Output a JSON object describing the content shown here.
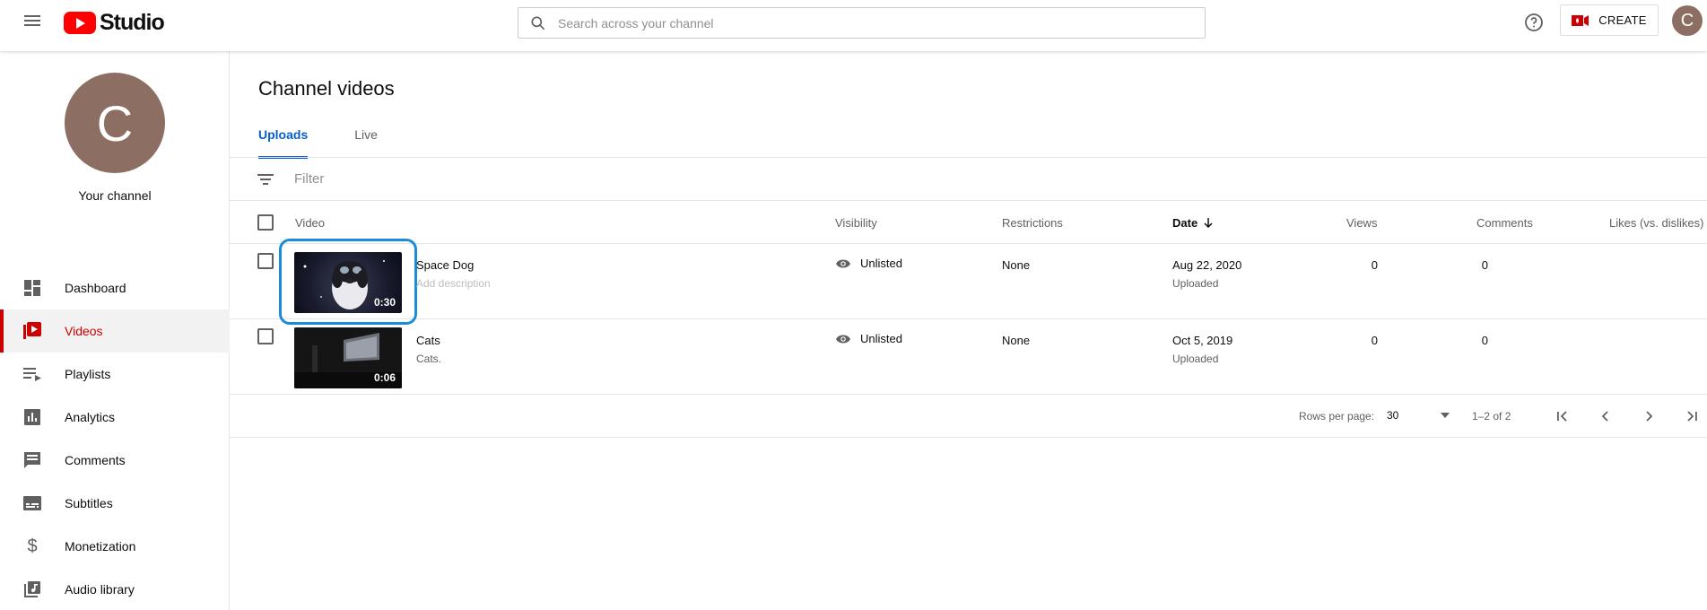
{
  "header": {
    "logo_text": "Studio",
    "search_placeholder": "Search across your channel",
    "create_label": "CREATE",
    "avatar_letter": "C"
  },
  "sidebar": {
    "avatar_letter": "C",
    "channel_label": "Your channel",
    "items": [
      {
        "label": "Dashboard",
        "icon": "dashboard-icon"
      },
      {
        "label": "Videos",
        "icon": "videos-icon",
        "active": true
      },
      {
        "label": "Playlists",
        "icon": "playlists-icon"
      },
      {
        "label": "Analytics",
        "icon": "analytics-icon"
      },
      {
        "label": "Comments",
        "icon": "comments-icon"
      },
      {
        "label": "Subtitles",
        "icon": "subtitles-icon"
      },
      {
        "label": "Monetization",
        "icon": "dollar-icon"
      },
      {
        "label": "Audio library",
        "icon": "audio-library-icon"
      }
    ]
  },
  "main": {
    "title": "Channel videos",
    "tabs": [
      {
        "label": "Uploads",
        "active": true
      },
      {
        "label": "Live"
      }
    ],
    "filter_placeholder": "Filter",
    "columns": {
      "video": "Video",
      "visibility": "Visibility",
      "restrictions": "Restrictions",
      "date": "Date",
      "views": "Views",
      "comments": "Comments",
      "likes": "Likes (vs. dislikes)"
    },
    "rows": [
      {
        "title": "Space Dog",
        "description": "Add description",
        "duration": "0:30",
        "visibility": "Unlisted",
        "restrictions": "None",
        "date": "Aug 22, 2020",
        "date_status": "Uploaded",
        "views": "0",
        "comments": "0",
        "likes": "–"
      },
      {
        "title": "Cats",
        "description": "Cats.",
        "duration": "0:06",
        "visibility": "Unlisted",
        "restrictions": "None",
        "date": "Oct 5, 2019",
        "date_status": "Uploaded",
        "views": "0",
        "comments": "0",
        "likes": "–"
      }
    ],
    "pagination": {
      "rows_per_page_label": "Rows per page:",
      "rows_per_page": "30",
      "range": "1–2 of 2"
    }
  },
  "colors": {
    "accent_red": "#cc0000",
    "tab_blue": "#065fd4",
    "highlight": "#1a8cd8",
    "avatar": "#8d6e63"
  }
}
